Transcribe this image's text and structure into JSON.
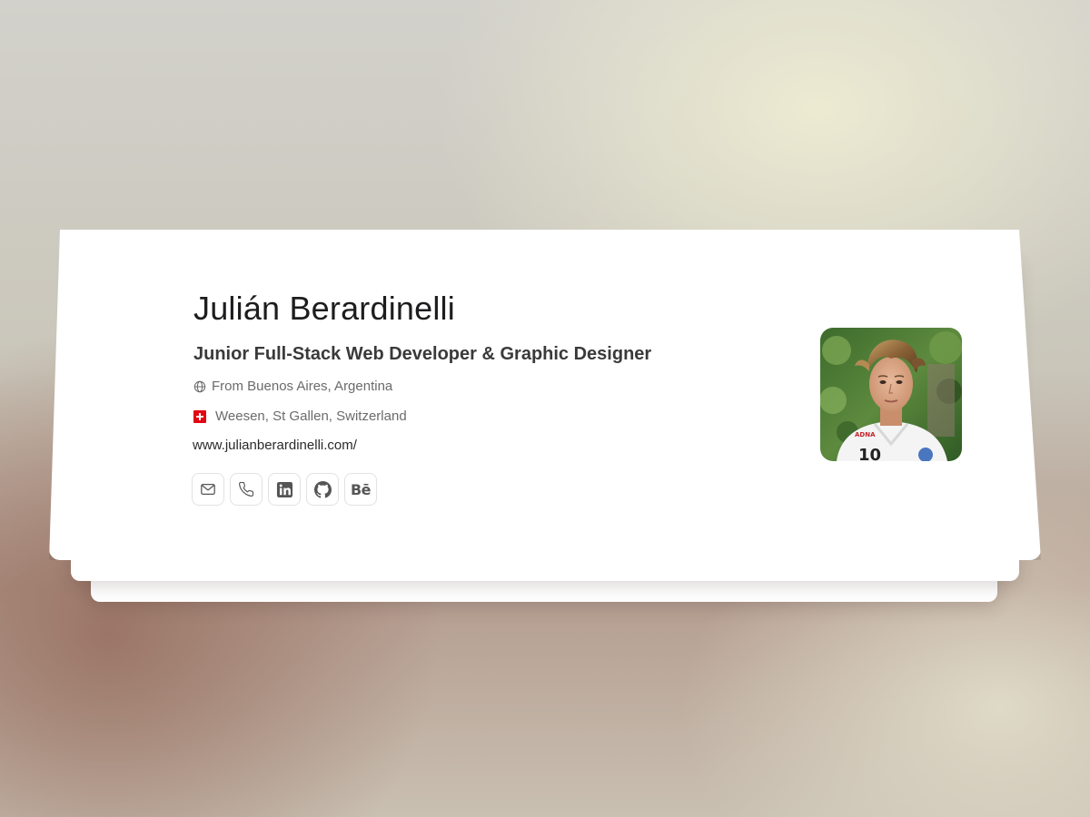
{
  "profile": {
    "name": "Julián Berardinelli",
    "role": "Junior Full-Stack Web Developer & Graphic Designer",
    "origin": "From Buenos Aires, Argentina",
    "current_location": "Weesen, St Gallen, Switzerland",
    "website": "www.julianberardinelli.com/"
  },
  "icons": {
    "origin": "globe-icon",
    "current_location": "swiss-flag-icon"
  },
  "socials": [
    {
      "name": "email",
      "icon": "mail-icon"
    },
    {
      "name": "phone",
      "icon": "phone-icon"
    },
    {
      "name": "linkedin",
      "icon": "linkedin-icon"
    },
    {
      "name": "github",
      "icon": "github-icon"
    },
    {
      "name": "behance",
      "icon": "behance-icon",
      "label": "Bē"
    }
  ],
  "colors": {
    "card": "#ffffff",
    "name_text": "#1d1d1f",
    "role_text": "#3a3a3a",
    "muted_text": "#6b6b6b",
    "swiss_red": "#e30613"
  }
}
